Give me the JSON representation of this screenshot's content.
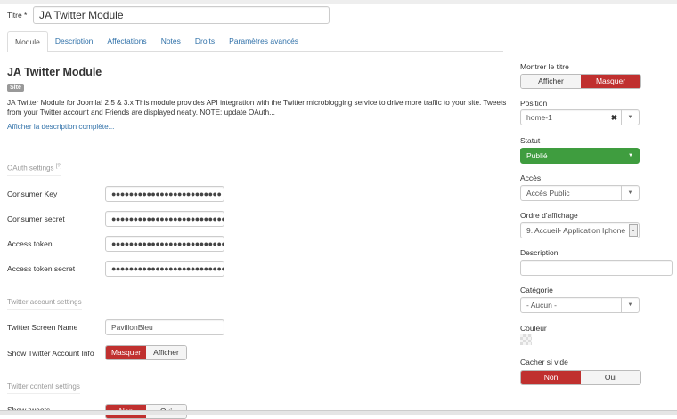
{
  "title_field": {
    "label": "Titre *",
    "value": "JA Twitter Module"
  },
  "tabs": [
    "Module",
    "Description",
    "Affectations",
    "Notes",
    "Droits",
    "Paramètres avancés"
  ],
  "module": {
    "heading": "JA Twitter Module",
    "badge": "Site",
    "description_line1": "JA Twitter Module for Joomla! 2.5 & 3.x This module provides API integration with the Twitter microblogging service to drive more traffic to your site. Tweets",
    "description_line2": "from your Twitter account and Friends are displayed neatly. NOTE: update OAuth...",
    "more_link": "Afficher la description complète..."
  },
  "oauth": {
    "legend": "OAuth settings",
    "help": "[?]",
    "fields": [
      {
        "label": "Consumer Key",
        "value": "●●●●●●●●●●●●●●●●●●●●●●●●●"
      },
      {
        "label": "Consumer secret",
        "value": "●●●●●●●●●●●●●●●●●●●●●●●●●●●"
      },
      {
        "label": "Access token",
        "value": "●●●●●●●●●●●●●●●●●●●●●●●●●●●"
      },
      {
        "label": "Access token secret",
        "value": "●●●●●●●●●●●●●●●●●●●●●●●●●●●"
      }
    ]
  },
  "account": {
    "legend": "Twitter account settings",
    "screen_name_label": "Twitter Screen Name",
    "screen_name": "PavillonBleu",
    "show_info_label": "Show Twitter Account Info",
    "show_info_options": [
      "Masquer",
      "Afficher"
    ]
  },
  "content": {
    "legend": "Twitter content settings",
    "show_tweets_label": "Show tweets",
    "show_tweets_options": [
      "Non",
      "Oui"
    ]
  },
  "sidebar": {
    "show_title": {
      "label": "Montrer le titre",
      "options": [
        "Afficher",
        "Masquer"
      ]
    },
    "position": {
      "label": "Position",
      "value": "home-1"
    },
    "status": {
      "label": "Statut",
      "value": "Publié",
      "color": "#3f9d3f"
    },
    "access": {
      "label": "Accès",
      "value": "Accès Public"
    },
    "ordering": {
      "label": "Ordre d'affichage",
      "value": "9. Accueil- Application Iphone"
    },
    "description": {
      "label": "Description",
      "value": ""
    },
    "category": {
      "label": "Catégorie",
      "value": "- Aucun -"
    },
    "color": {
      "label": "Couleur"
    },
    "hide_empty": {
      "label": "Cacher si vide",
      "options": [
        "Non",
        "Oui"
      ]
    }
  }
}
